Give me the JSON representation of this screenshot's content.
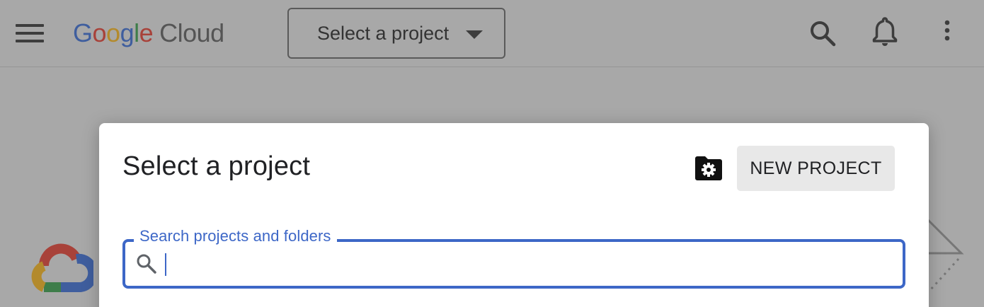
{
  "header": {
    "menu_icon": "hamburger-menu-icon",
    "logo": {
      "letters": [
        "G",
        "o",
        "o",
        "g",
        "l",
        "e"
      ],
      "product": "Cloud"
    },
    "project_picker_label": "Select a project",
    "icons": [
      "search-icon",
      "notifications-bell-icon",
      "more-vert-icon"
    ]
  },
  "dialog": {
    "title": "Select a project",
    "manage_resources_icon": "folder-gear-icon",
    "new_project_label": "NEW PROJECT",
    "search": {
      "label": "Search projects and folders",
      "value": ""
    }
  },
  "colors": {
    "accent_blue": "#3d67c7",
    "overlay_bg": "#a8a8a8",
    "button_bg": "#e8e8e8"
  }
}
